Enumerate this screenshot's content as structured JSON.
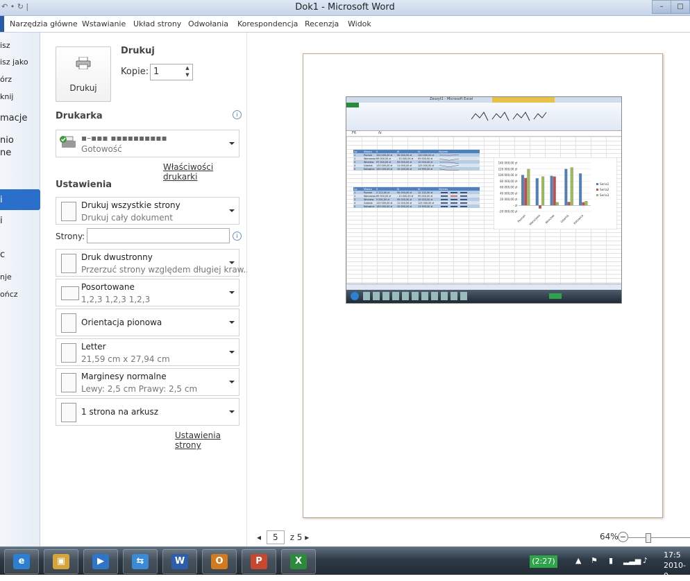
{
  "window": {
    "title": "Dok1 - Microsoft Word",
    "qat": "↶ • ↻ |",
    "btn_min": "–",
    "btn_max": "□"
  },
  "tabs": [
    "Narzędzia główne",
    "Wstawianie",
    "Układ strony",
    "Odwołania",
    "Korespondencja",
    "Recenzja",
    "Widok"
  ],
  "nav": [
    "isz",
    "isz jako",
    "órz",
    "knij",
    "macje",
    "nio",
    "ne",
    "i",
    "i",
    "c",
    "nje",
    "ończ"
  ],
  "print": {
    "heading": "Drukuj",
    "button_label": "Drukuj",
    "copies_label": "Kopie:",
    "copies_value": "1"
  },
  "printer": {
    "heading": "Drukarka",
    "name": "▪–▪▪▪ ▪▪▪▪▪▪▪▪▪▪",
    "status": "Gotowość",
    "properties_link": "Właściwości drukarki"
  },
  "settings": {
    "heading": "Ustawienia",
    "pages_label": "Strony:",
    "pages_value": "",
    "options": [
      {
        "l1": "Drukuj wszystkie strony",
        "l2": "Drukuj cały dokument"
      },
      {
        "l1": "Druk dwustronny",
        "l2": "Przerzuć strony względem długiej kraw..."
      },
      {
        "l1": "Posortowane",
        "l2": "1,2,3    1,2,3    1,2,3"
      },
      {
        "l1": "Orientacja pionowa",
        "l2": ""
      },
      {
        "l1": "Letter",
        "l2": "21,59 cm x 27,94 cm"
      },
      {
        "l1": "Marginesy normalne",
        "l2": "Lewy:  2,5 cm    Prawy:  2,5 cm"
      },
      {
        "l1": "1 strona na arkusz",
        "l2": ""
      }
    ],
    "page_setup_link": "Ustawienia strony"
  },
  "preview": {
    "current_page": "5",
    "total_label": "z 5",
    "zoom_label": "64%",
    "prev_glyph": "◂",
    "next_glyph": "▸",
    "zoom_minus": "−"
  },
  "embedded": {
    "title": "Zeszyt1 - Microsoft Excel",
    "name_box": "F6",
    "fx": "fx",
    "table1_headers": [
      "Lp.",
      "Miasto",
      "II",
      "III",
      "IV",
      "Wykres"
    ],
    "table1": [
      [
        "1",
        "Poznań",
        "100 000,00 zł",
        "90 000,00 zł",
        "120 000,00 zł"
      ],
      [
        "2",
        "Warszawa",
        "89 000,00 zł",
        "- 10 000,00 zł",
        "95 000,00 zł"
      ],
      [
        "3",
        "Wrocław",
        "97 000,00 zł",
        "95 000,00 zł",
        "10 000,00 zł"
      ],
      [
        "4",
        "Gdańsk",
        "120 000,00 zł",
        "11 000,00 zł",
        "125 000,00 zł"
      ],
      [
        "5",
        "Katowice",
        "105 000,00 zł",
        "10 000,00 zł",
        "13 999,00 zł"
      ]
    ],
    "table2": [
      [
        "1",
        "Poznań",
        "2 212,00 zł",
        "90 000,00 zł",
        "12 132,00 zł"
      ],
      [
        "2",
        "Warszawa",
        "89 000,00 zł",
        "- 10 000,00 zł",
        "95 000,00 zł"
      ],
      [
        "3",
        "Wrocław",
        "5 000,00 zł",
        "95 000,00 zł",
        "10 000,00 zł"
      ],
      [
        "4",
        "Gdańsk",
        "120 000,00 zł",
        "11 000,00 zł",
        "125 000,00 zł"
      ],
      [
        "5",
        "Katowice",
        "105 000,00 zł",
        "10 000,00 zł",
        "13 999,00 zł"
      ]
    ],
    "chart": {
      "type": "bar",
      "categories": [
        "Poznań",
        "Warszawa",
        "Wrocław",
        "Gdańsk",
        "Katowice"
      ],
      "series": [
        {
          "name": "Seria1",
          "values": [
            100000,
            89000,
            97000,
            120000,
            105000
          ],
          "color": "#4f81bd"
        },
        {
          "name": "Seria2",
          "values": [
            90000,
            -10000,
            95000,
            11000,
            10000
          ],
          "color": "#c0504d"
        },
        {
          "name": "Seria3",
          "values": [
            120000,
            95000,
            10000,
            125000,
            13999
          ],
          "color": "#9bbb59"
        }
      ],
      "ylim": [
        -20000,
        140000
      ],
      "ticks": [
        "140 000,00 zł",
        "120 000,00 zł",
        "100 000,00 zł",
        "80 000,00 zł",
        "60 000,00 zł",
        "40 000,00 zł",
        "20 000,00 zł",
        "- zł",
        "-20 000,00 zł"
      ],
      "legend": "right"
    }
  },
  "taskbar": {
    "apps": [
      "e",
      "▣",
      "▶",
      "⇆",
      "W",
      "O",
      "P",
      "X"
    ],
    "app_colors": [
      "#2d7fd2",
      "#d6a43a",
      "#2f76c8",
      "#3a8ad6",
      "#2b5fae",
      "#d27a1f",
      "#c9462f",
      "#2d8a3d"
    ],
    "battery": "(2:27)",
    "tray": [
      "▲",
      "⚑",
      "▮",
      "▂▃▅",
      "♪"
    ],
    "time": "17:5",
    "date": "2010-0"
  }
}
